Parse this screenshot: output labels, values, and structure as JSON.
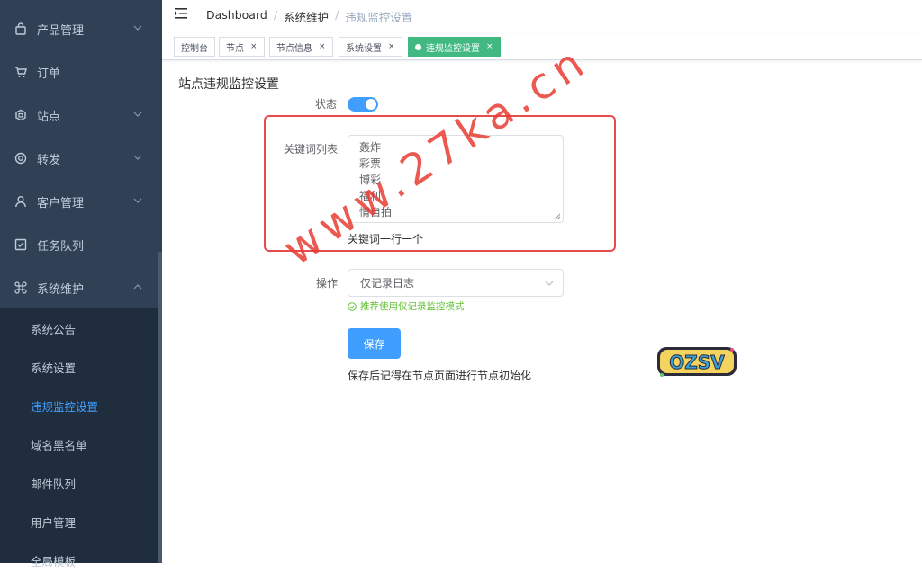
{
  "sidebar": {
    "items": [
      {
        "label": "产品管理",
        "icon": "bag-icon",
        "has_arrow": true
      },
      {
        "label": "订单",
        "icon": "cart-icon",
        "has_arrow": false
      },
      {
        "label": "站点",
        "icon": "site-icon",
        "has_arrow": true
      },
      {
        "label": "转发",
        "icon": "target-icon",
        "has_arrow": true
      },
      {
        "label": "客户管理",
        "icon": "user-icon",
        "has_arrow": true
      },
      {
        "label": "任务队列",
        "icon": "checkbox-icon",
        "has_arrow": false
      },
      {
        "label": "系统维护",
        "icon": "command-icon",
        "has_arrow": true,
        "expanded": true
      }
    ],
    "subitems": [
      {
        "label": "系统公告"
      },
      {
        "label": "系统设置"
      },
      {
        "label": "违规监控设置",
        "active": true
      },
      {
        "label": "域名黑名单"
      },
      {
        "label": "邮件队列"
      },
      {
        "label": "用户管理"
      },
      {
        "label": "全局模板"
      }
    ]
  },
  "breadcrumb": [
    "Dashboard",
    "系统维护",
    "违规监控设置"
  ],
  "tags": [
    {
      "label": "控制台",
      "closable": false
    },
    {
      "label": "节点",
      "closable": true
    },
    {
      "label": "节点信息",
      "closable": true
    },
    {
      "label": "系统设置",
      "closable": true
    },
    {
      "label": "违规监控设置",
      "closable": true,
      "active": true
    }
  ],
  "form": {
    "title": "站点违规监控设置",
    "status_label": "状态",
    "status_on": true,
    "keywords_label": "关键词列表",
    "keywords": [
      "轰炸",
      "彩票",
      "博彩",
      "福利",
      "情自拍"
    ],
    "keywords_hint": "关键词一行一个",
    "action_label": "操作",
    "action_value": "仅记录日志",
    "action_tip": "推荐使用仅记录监控模式",
    "save_label": "保存",
    "save_note": "保存后记得在节点页面进行节点初始化"
  },
  "watermark": "www.27ka.cn",
  "logo_text": "OZSV",
  "colors": {
    "sidebar_bg": "#304156",
    "submenu_bg": "#1f2d3d",
    "primary": "#409eff",
    "tag_active": "#42b983",
    "success": "#67c23a",
    "highlight_box": "#e74c4c"
  }
}
